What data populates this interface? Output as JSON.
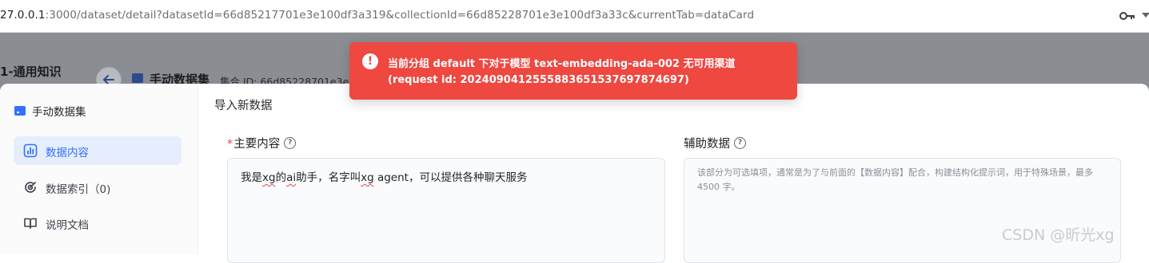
{
  "browser": {
    "url_host": "27.0.0.1",
    "url_rest": ":3000/dataset/detail?datasetId=66d85217701e3e100df3a319&collectionId=66d85228701e3e100df3a33c&currentTab=dataCard",
    "icons": [
      "key-icon",
      "menu-chevron-icon"
    ]
  },
  "background_app": {
    "sidebar_title": "1-通用知识",
    "collection_title": "手动数据集",
    "collection_id": "集合 ID: 66d85228701e3e"
  },
  "modal": {
    "sidebar_header": "手动数据集",
    "nav": [
      {
        "label": "数据内容",
        "icon": "bar-chart-icon",
        "active": true
      },
      {
        "label": "数据索引（0)",
        "icon": "index-icon",
        "active": false
      },
      {
        "label": "说明文档",
        "icon": "book-icon",
        "active": false
      }
    ],
    "title": "导入新数据",
    "main_field": {
      "required_mark": "*",
      "label": "主要内容",
      "value_parts": [
        "我是",
        "xg",
        "的",
        "ai",
        "助手，名字叫",
        "xg",
        " agent，可以提供各种聊天服务"
      ]
    },
    "aux_field": {
      "label": "辅助数据",
      "placeholder": "该部分为可选填项，通常是为了与前面的【数据内容】配合，构建结构化提示词，用于特殊场景，最多 4500 字。"
    }
  },
  "toast": {
    "line1": "当前分组 default 下对于模型 text-embedding-ada-002 无可用渠道",
    "line2": "(request id: 20240904125558836515376978746​97)",
    "icon": "error-icon",
    "color": "#ee4840"
  },
  "watermark": "CSDN @昕光xg",
  "colors": {
    "accent": "#3370ff",
    "backdrop": "#8a8d92"
  }
}
